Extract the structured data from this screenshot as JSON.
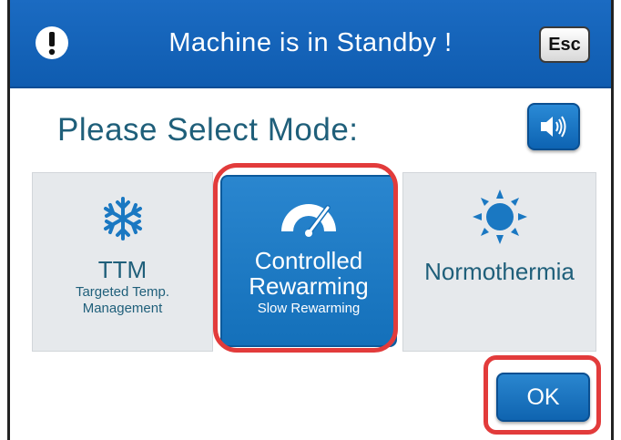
{
  "header": {
    "title": "Machine is in Standby !",
    "esc_label": "Esc",
    "alert_icon": "exclamation-circle-icon"
  },
  "main": {
    "prompt": "Please Select Mode:",
    "sound_icon": "speaker-icon"
  },
  "modes": [
    {
      "name": "TTM",
      "sub_line1": "Targeted Temp.",
      "sub_line2": "Management",
      "icon": "snowflake-icon",
      "selected": false
    },
    {
      "name_line1": "Controlled",
      "name_line2": "Rewarming",
      "sub": "Slow Rewarming",
      "icon": "gauge-icon",
      "selected": true
    },
    {
      "name": "Normothermia",
      "icon": "sun-icon",
      "selected": false
    }
  ],
  "footer": {
    "ok_label": "OK"
  },
  "colors": {
    "header_blue": "#1564bb",
    "accent_blue": "#1a78c2",
    "text_teal": "#1f5f7a",
    "highlight_red": "#e23b3b",
    "tile_gray": "#e6e9ec"
  }
}
